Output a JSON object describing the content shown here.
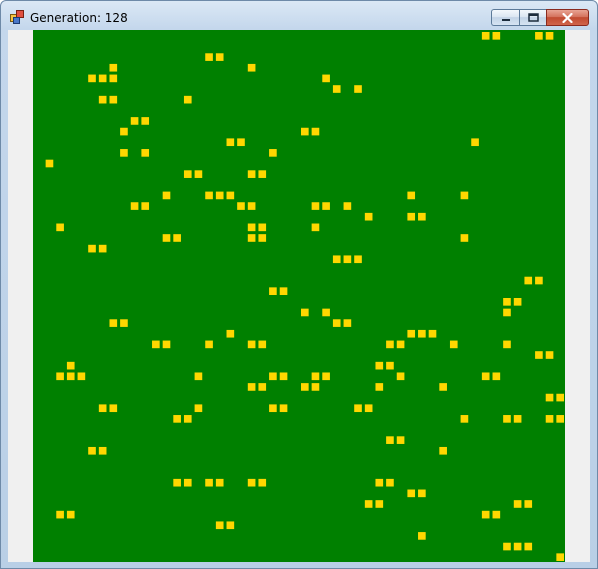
{
  "window": {
    "title": "Generation: 128",
    "icons": {
      "app": "app-icon",
      "minimize": "minimize-icon",
      "maximize": "maximize-icon",
      "close": "close-icon"
    }
  },
  "board": {
    "background_color": "#008000",
    "cell_color": "#ffd700",
    "live_cells": [
      [
        42,
        0
      ],
      [
        43,
        0
      ],
      [
        47,
        0
      ],
      [
        48,
        0
      ],
      [
        16,
        2
      ],
      [
        17,
        2
      ],
      [
        20,
        3
      ],
      [
        7,
        3
      ],
      [
        5,
        4
      ],
      [
        6,
        4
      ],
      [
        7,
        4
      ],
      [
        27,
        4
      ],
      [
        28,
        5
      ],
      [
        30,
        5
      ],
      [
        6,
        6
      ],
      [
        7,
        6
      ],
      [
        14,
        6
      ],
      [
        9,
        8
      ],
      [
        10,
        8
      ],
      [
        8,
        9
      ],
      [
        25,
        9
      ],
      [
        26,
        9
      ],
      [
        18,
        10
      ],
      [
        19,
        10
      ],
      [
        41,
        10
      ],
      [
        8,
        11
      ],
      [
        10,
        11
      ],
      [
        22,
        11
      ],
      [
        1,
        12
      ],
      [
        14,
        13
      ],
      [
        15,
        13
      ],
      [
        20,
        13
      ],
      [
        21,
        13
      ],
      [
        12,
        15
      ],
      [
        16,
        15
      ],
      [
        17,
        15
      ],
      [
        18,
        15
      ],
      [
        35,
        15
      ],
      [
        40,
        15
      ],
      [
        9,
        16
      ],
      [
        10,
        16
      ],
      [
        19,
        16
      ],
      [
        20,
        16
      ],
      [
        26,
        16
      ],
      [
        27,
        16
      ],
      [
        29,
        16
      ],
      [
        31,
        17
      ],
      [
        35,
        17
      ],
      [
        36,
        17
      ],
      [
        2,
        18
      ],
      [
        20,
        18
      ],
      [
        21,
        18
      ],
      [
        26,
        18
      ],
      [
        12,
        19
      ],
      [
        13,
        19
      ],
      [
        20,
        19
      ],
      [
        21,
        19
      ],
      [
        40,
        19
      ],
      [
        5,
        20
      ],
      [
        6,
        20
      ],
      [
        28,
        21
      ],
      [
        29,
        21
      ],
      [
        30,
        21
      ],
      [
        46,
        23
      ],
      [
        47,
        23
      ],
      [
        22,
        24
      ],
      [
        23,
        24
      ],
      [
        44,
        25
      ],
      [
        45,
        25
      ],
      [
        25,
        26
      ],
      [
        27,
        26
      ],
      [
        44,
        26
      ],
      [
        7,
        27
      ],
      [
        8,
        27
      ],
      [
        28,
        27
      ],
      [
        29,
        27
      ],
      [
        18,
        28
      ],
      [
        35,
        28
      ],
      [
        36,
        28
      ],
      [
        37,
        28
      ],
      [
        11,
        29
      ],
      [
        12,
        29
      ],
      [
        16,
        29
      ],
      [
        20,
        29
      ],
      [
        21,
        29
      ],
      [
        33,
        29
      ],
      [
        34,
        29
      ],
      [
        39,
        29
      ],
      [
        44,
        29
      ],
      [
        47,
        30
      ],
      [
        48,
        30
      ],
      [
        3,
        31
      ],
      [
        32,
        31
      ],
      [
        33,
        31
      ],
      [
        2,
        32
      ],
      [
        3,
        32
      ],
      [
        4,
        32
      ],
      [
        15,
        32
      ],
      [
        22,
        32
      ],
      [
        23,
        32
      ],
      [
        26,
        32
      ],
      [
        27,
        32
      ],
      [
        34,
        32
      ],
      [
        42,
        32
      ],
      [
        43,
        32
      ],
      [
        20,
        33
      ],
      [
        21,
        33
      ],
      [
        25,
        33
      ],
      [
        26,
        33
      ],
      [
        32,
        33
      ],
      [
        38,
        33
      ],
      [
        48,
        34
      ],
      [
        49,
        34
      ],
      [
        6,
        35
      ],
      [
        7,
        35
      ],
      [
        15,
        35
      ],
      [
        22,
        35
      ],
      [
        23,
        35
      ],
      [
        30,
        35
      ],
      [
        31,
        35
      ],
      [
        13,
        36
      ],
      [
        14,
        36
      ],
      [
        40,
        36
      ],
      [
        44,
        36
      ],
      [
        45,
        36
      ],
      [
        48,
        36
      ],
      [
        49,
        36
      ],
      [
        33,
        38
      ],
      [
        34,
        38
      ],
      [
        5,
        39
      ],
      [
        6,
        39
      ],
      [
        38,
        39
      ],
      [
        13,
        42
      ],
      [
        14,
        42
      ],
      [
        16,
        42
      ],
      [
        17,
        42
      ],
      [
        20,
        42
      ],
      [
        21,
        42
      ],
      [
        32,
        42
      ],
      [
        33,
        42
      ],
      [
        35,
        43
      ],
      [
        36,
        43
      ],
      [
        31,
        44
      ],
      [
        32,
        44
      ],
      [
        45,
        44
      ],
      [
        46,
        44
      ],
      [
        2,
        45
      ],
      [
        3,
        45
      ],
      [
        42,
        45
      ],
      [
        43,
        45
      ],
      [
        17,
        46
      ],
      [
        18,
        46
      ],
      [
        36,
        47
      ],
      [
        44,
        48
      ],
      [
        45,
        48
      ],
      [
        46,
        48
      ],
      [
        25,
        50
      ],
      [
        26,
        50
      ],
      [
        44,
        50
      ],
      [
        45,
        50
      ],
      [
        20,
        51
      ],
      [
        21,
        51
      ],
      [
        30,
        51
      ],
      [
        31,
        51
      ],
      [
        49,
        49
      ]
    ]
  }
}
